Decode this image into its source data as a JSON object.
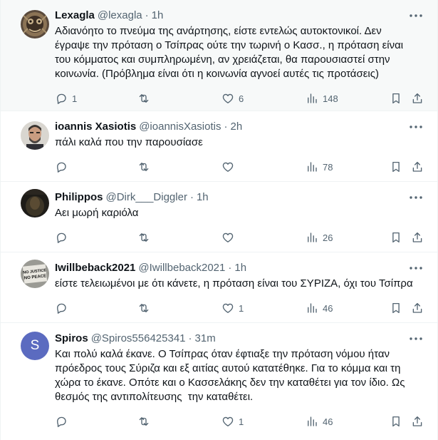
{
  "tweets": [
    {
      "name": "Lexagla",
      "handle": "@lexagla",
      "time": "1h",
      "text": "Αδιανόητο το πνεύμα της ανάρτησης, είστε εντελώς αυτοκτονικοί. Δεν\nέγραψε την πρόταση ο Τσίπρας ούτε την τωρινή ο Κασσ., η πρόταση είναι\nτου κόμματος και συμπληρωμένη, αν χρειάζεται, θα παρουσιαστεί στην\nκοινωνία. (Πρόβλημα είναι ότι η κοινωνία αγνοεί αυτές τις προτάσεις)",
      "replies": "1",
      "retweets": "",
      "likes": "6",
      "views": "148"
    },
    {
      "name": "ioannis Xasiotis",
      "handle": "@ioannisXasiotis",
      "time": "2h",
      "text": "πάλι καλά που την παρουσίασε",
      "replies": "",
      "retweets": "",
      "likes": "",
      "views": "78"
    },
    {
      "name": "Philippos",
      "handle": "@Dirk___Diggler",
      "time": "1h",
      "text": "Αει μωρή καριόλα",
      "replies": "",
      "retweets": "",
      "likes": "",
      "views": "26"
    },
    {
      "name": "Iwillbeback2021",
      "handle": "@Iwillbeback2021",
      "time": "1h",
      "text": "είστε τελειωμένοι με ότι κάνετε, η πρόταση είναι του ΣΥΡΙΖΑ, όχι του Τσίπρα",
      "replies": "",
      "retweets": "",
      "likes": "1",
      "views": "46",
      "avatar_text": "NO JUSTICE\nNO PEACE"
    },
    {
      "name": "Spiros",
      "handle": "@Spiros556425341",
      "time": "31m",
      "text": "Και πολύ καλά έκανε. Ο Τσίπρας όταν έφτιαξε την πρόταση νόμου ήταν\nπρόεδρος τους Σύριζα και εξ αιτίας αυτού κατατέθηκε. Για το κόμμα και τη\nχώρα το έκανε. Οπότε και ο Κασσελάκης δεν την καταθέτει για τον ίδιο. Ως\nθεσμός της αντιπολίτευσης  την καταθέτει.",
      "replies": "",
      "retweets": "",
      "likes": "1",
      "views": "46",
      "avatar_letter": "S"
    }
  ],
  "colors": {
    "text": "#0f1419",
    "secondary": "#536471",
    "divider": "#eff3f4",
    "highlight_bg": "#f7f9f9",
    "spiros_avatar": "#5b6bc0"
  }
}
